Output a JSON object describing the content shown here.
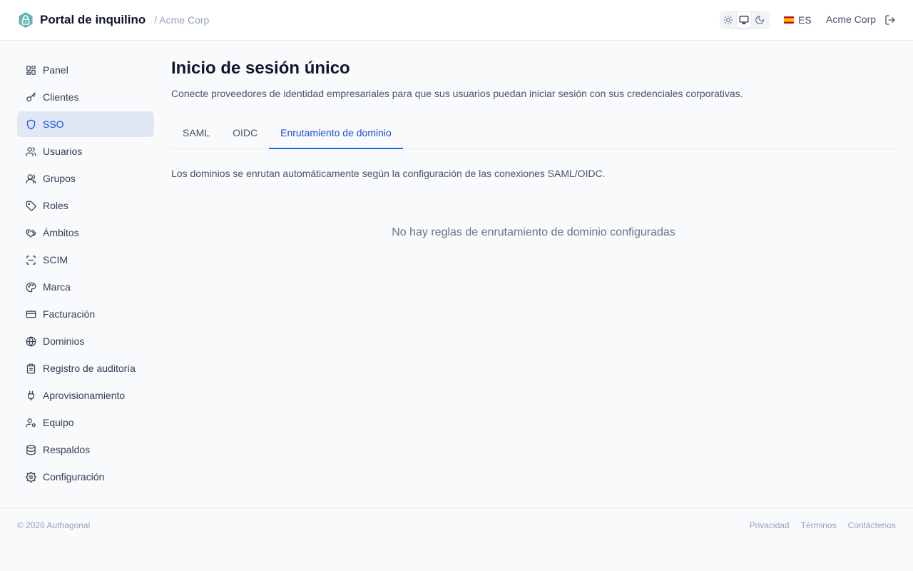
{
  "header": {
    "title": "Portal de inquilino",
    "tenant": "/ Acme Corp",
    "theme_options": [
      "light",
      "system",
      "dark"
    ],
    "theme_selected": "system",
    "language_flag": "spain-flag-icon",
    "language_code": "ES",
    "account_name": "Acme Corp"
  },
  "sidebar": {
    "items": [
      {
        "label": "Panel",
        "icon": "dashboard-icon",
        "active": false
      },
      {
        "label": "Clientes",
        "icon": "key-icon",
        "active": false
      },
      {
        "label": "SSO",
        "icon": "shield-icon",
        "active": true
      },
      {
        "label": "Usuarios",
        "icon": "users-icon",
        "active": false
      },
      {
        "label": "Grupos",
        "icon": "group-icon",
        "active": false
      },
      {
        "label": "Roles",
        "icon": "tag-icon",
        "active": false
      },
      {
        "label": "Ámbitos",
        "icon": "tags-icon",
        "active": false
      },
      {
        "label": "SCIM",
        "icon": "scan-icon",
        "active": false
      },
      {
        "label": "Marca",
        "icon": "palette-icon",
        "active": false
      },
      {
        "label": "Facturación",
        "icon": "credit-card-icon",
        "active": false
      },
      {
        "label": "Dominios",
        "icon": "globe-icon",
        "active": false
      },
      {
        "label": "Registro de auditoría",
        "icon": "clipboard-icon",
        "active": false
      },
      {
        "label": "Aprovisionamiento",
        "icon": "plug-icon",
        "active": false
      },
      {
        "label": "Equipo",
        "icon": "user-cog-icon",
        "active": false
      },
      {
        "label": "Respaldos",
        "icon": "database-icon",
        "active": false
      },
      {
        "label": "Configuración",
        "icon": "gear-icon",
        "active": false
      }
    ]
  },
  "main": {
    "title": "Inicio de sesión único",
    "description": "Conecte proveedores de identidad empresariales para que sus usuarios puedan iniciar sesión con sus credenciales corporativas.",
    "tabs": [
      {
        "label": "SAML",
        "active": false
      },
      {
        "label": "OIDC",
        "active": false
      },
      {
        "label": "Enrutamiento de dominio",
        "active": true
      }
    ],
    "info_text": "Los dominios se enrutan automáticamente según la configuración de las conexiones SAML/OIDC.",
    "empty_text": "No hay reglas de enrutamiento de dominio configuradas"
  },
  "footer": {
    "copyright": "© 2026 Authagonal",
    "links": [
      "Privacidad",
      "Términos",
      "Contáctenos"
    ]
  },
  "colors": {
    "accent": "#1d4ed8",
    "active_bg": "#e0e7f5",
    "logo": "#5fb3b3",
    "background": "#f8fafc"
  }
}
